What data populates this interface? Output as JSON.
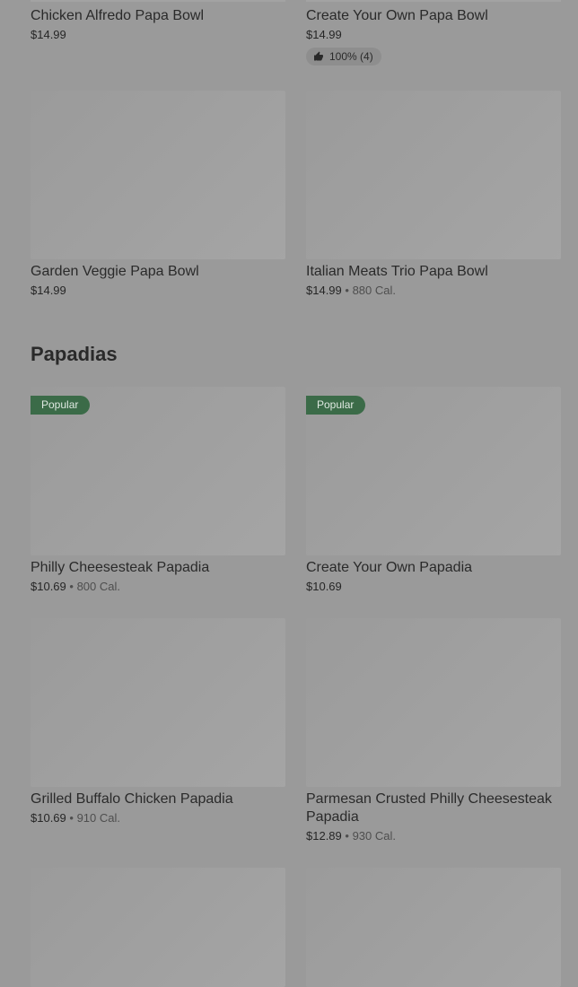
{
  "top_items": [
    {
      "name": "Chicken Alfredo Papa Bowl",
      "price": "$14.99"
    },
    {
      "name": "Create Your Own Papa Bowl",
      "price": "$14.99",
      "rating": "100% (4)"
    }
  ],
  "bowls": [
    {
      "name": "Garden Veggie Papa Bowl",
      "price": "$14.99"
    },
    {
      "name": "Italian Meats Trio Papa Bowl",
      "price": "$14.99",
      "calories": "880 Cal."
    }
  ],
  "section": {
    "title": "Papadias"
  },
  "papadias": [
    {
      "name": "Philly Cheesesteak Papadia",
      "price": "$10.69",
      "calories": "800 Cal.",
      "badge": "Popular"
    },
    {
      "name": "Create Your Own Papadia",
      "price": "$10.69",
      "badge": "Popular"
    },
    {
      "name": "Grilled Buffalo Chicken Papadia",
      "price": "$10.69",
      "calories": "910 Cal."
    },
    {
      "name": "Parmesan Crusted Philly Cheesesteak Papadia",
      "price": "$12.89",
      "calories": "930 Cal."
    }
  ],
  "separator": "•",
  "colors": {
    "badge_bg": "#3b6b48",
    "overlay": "#9a9a9a"
  },
  "icons": {
    "rating": "thumbs-up-icon"
  }
}
